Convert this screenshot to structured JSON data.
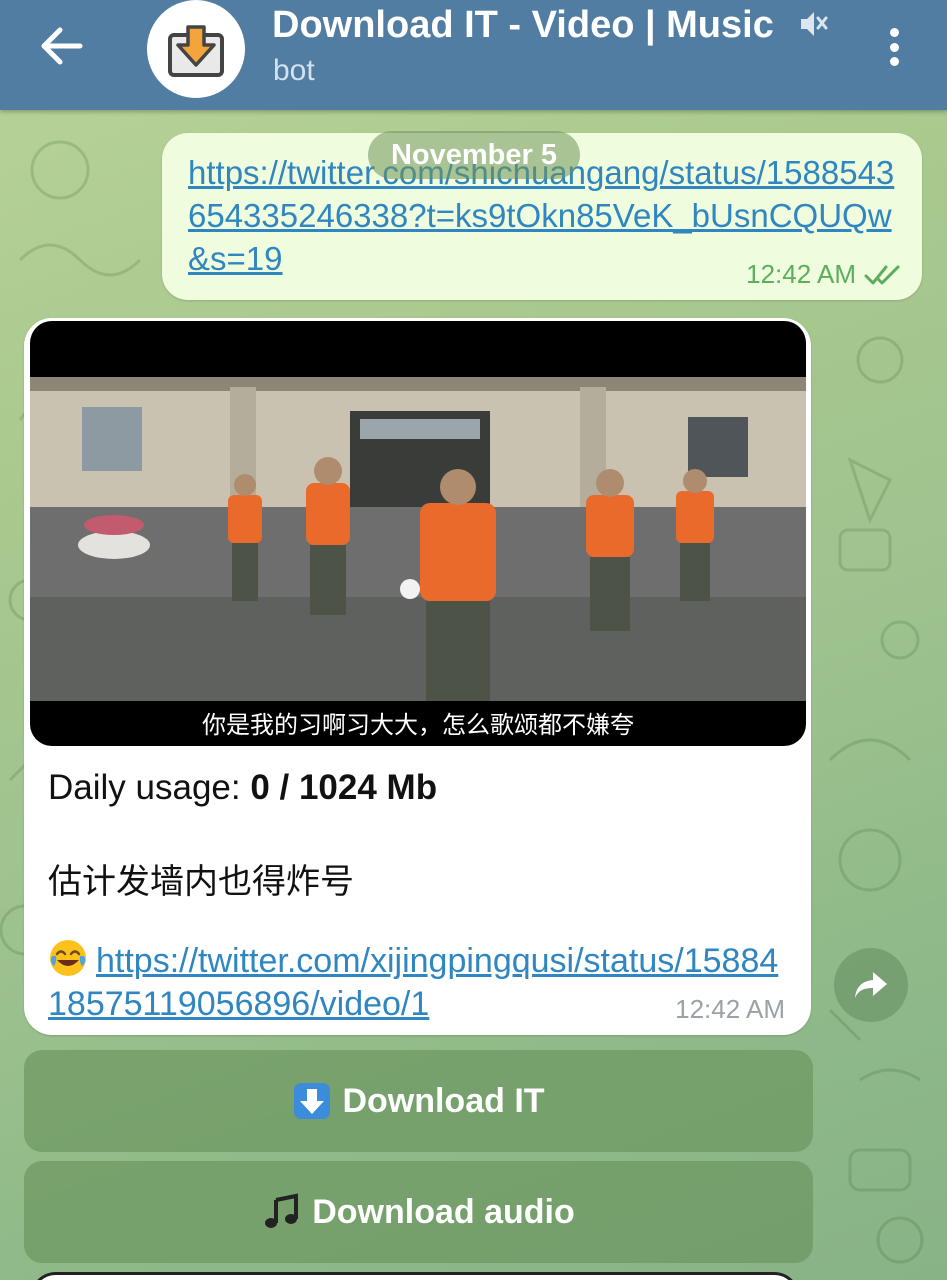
{
  "header": {
    "title": "Download IT - Video | Music",
    "subtitle": "bot"
  },
  "date_separator": "November 5",
  "outgoing_message": {
    "link": "https://twitter.com/shichuangang/status/1588543654335246338?t=ks9tOkn85VeK_bUsnCQUQw&s=19",
    "time": "12:42 AM",
    "status": "read"
  },
  "incoming_message": {
    "video_subtitle": "你是我的习啊习大大，怎么歌颂都不嫌夸",
    "usage_label": "Daily usage: ",
    "usage_value": "0 / 1024 Mb",
    "caption": "估计发墙内也得炸号",
    "emoji": "joy-emoji",
    "link": "https://twitter.com/xijingpingqusi/status/1588418575119056896/video/1",
    "time": "12:42 AM"
  },
  "keyboard": {
    "download_label": "Download IT",
    "download_icon": "down-arrow-emoji",
    "audio_label": "Download audio",
    "audio_icon": "music-note-emoji"
  },
  "colors": {
    "header": "#517da2",
    "outgoing_bubble": "#effdde",
    "link": "#2f86c0",
    "read_check": "#5cae5c"
  }
}
